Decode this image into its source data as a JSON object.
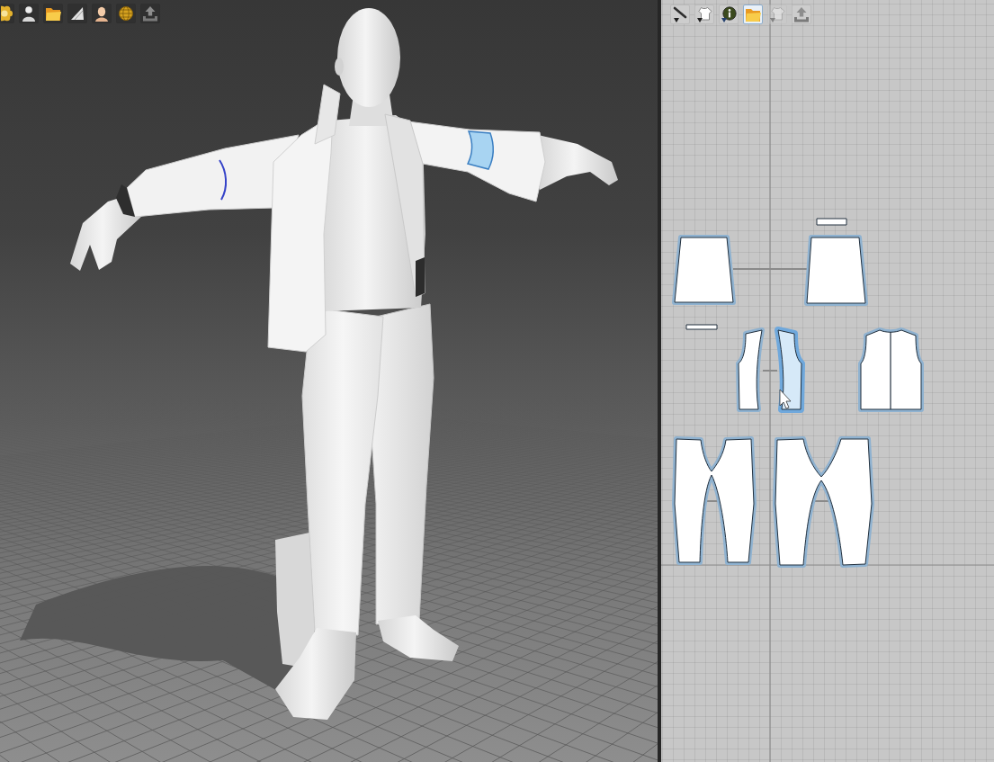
{
  "viewport_3d": {
    "toolbar": [
      {
        "kind": "flower"
      },
      {
        "kind": "person"
      },
      {
        "kind": "folder"
      },
      {
        "kind": "fabric"
      },
      {
        "kind": "bust"
      },
      {
        "kind": "globe"
      },
      {
        "kind": "upload"
      }
    ]
  },
  "pattern_window": {
    "toolbar": [
      {
        "kind": "needle",
        "selected": false,
        "disabled": false
      },
      {
        "kind": "shirt",
        "selected": false,
        "disabled": false
      },
      {
        "kind": "info",
        "selected": false,
        "disabled": false
      },
      {
        "kind": "folder",
        "selected": true,
        "disabled": false
      },
      {
        "kind": "shirt",
        "selected": false,
        "disabled": true
      },
      {
        "kind": "upload",
        "selected": false,
        "disabled": false
      }
    ],
    "pieces": [
      {
        "selected": false
      },
      {
        "selected": false
      },
      {
        "selected": false
      },
      {
        "selected": false
      },
      {
        "selected": false
      },
      {
        "selected": true
      },
      {
        "selected": false
      },
      {
        "selected": false
      },
      {
        "selected": false
      }
    ]
  }
}
